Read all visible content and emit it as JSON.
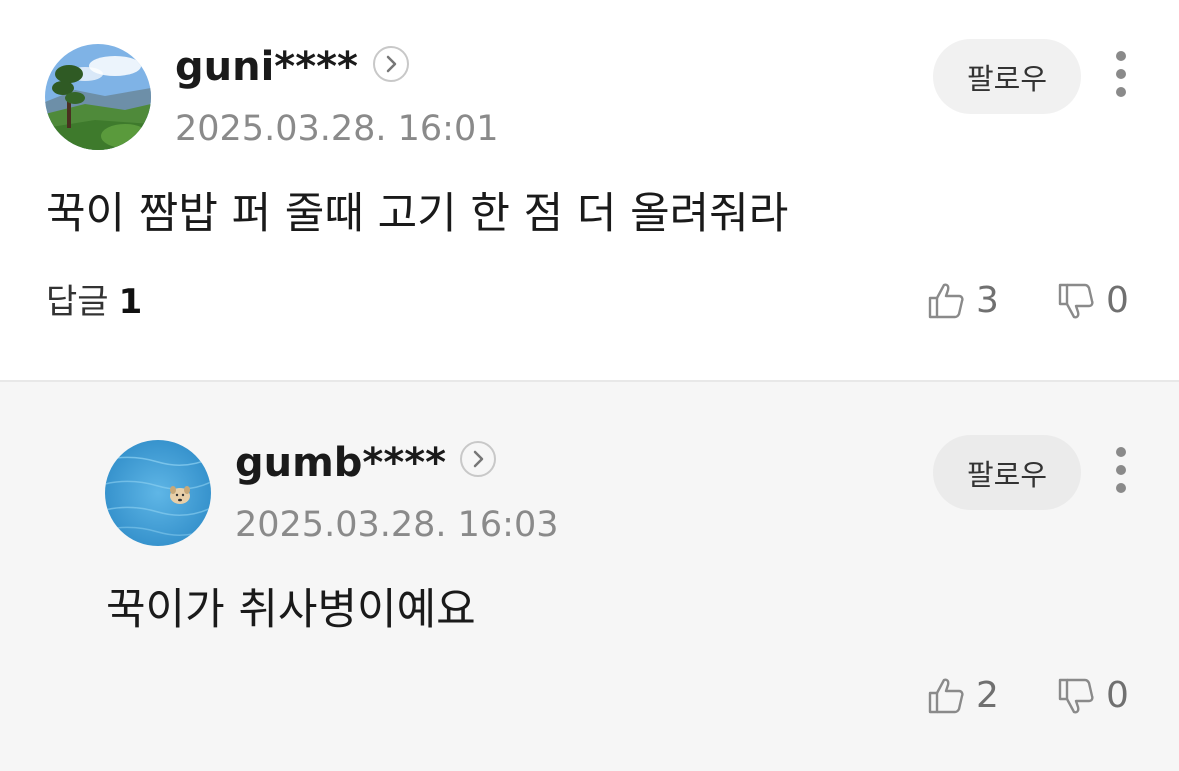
{
  "comments": [
    {
      "username": "guni****",
      "timestamp": "2025.03.28. 16:01",
      "follow_label": "팔로우",
      "text": "꾹이 짬밥 퍼 줄때 고기 한 점 더 올려줘라",
      "reply_label": "답글",
      "reply_count": "1",
      "likes": "3",
      "dislikes": "0",
      "avatar": "mountain-landscape-avatar"
    },
    {
      "username": "gumb****",
      "timestamp": "2025.03.28. 16:03",
      "follow_label": "팔로우",
      "text": "꾹이가 취사병이예요",
      "likes": "2",
      "dislikes": "0",
      "avatar": "dog-swimming-pool-avatar"
    }
  ],
  "icons": {
    "profile": "chevron-right-icon",
    "more": "more-vertical-icon",
    "like": "thumbs-up-icon",
    "dislike": "thumbs-down-icon"
  },
  "colors": {
    "text_primary": "#1a1a1a",
    "text_secondary": "#8a8a8a",
    "reply_background": "#f6f6f6",
    "button_background": "#f1f1f1"
  }
}
